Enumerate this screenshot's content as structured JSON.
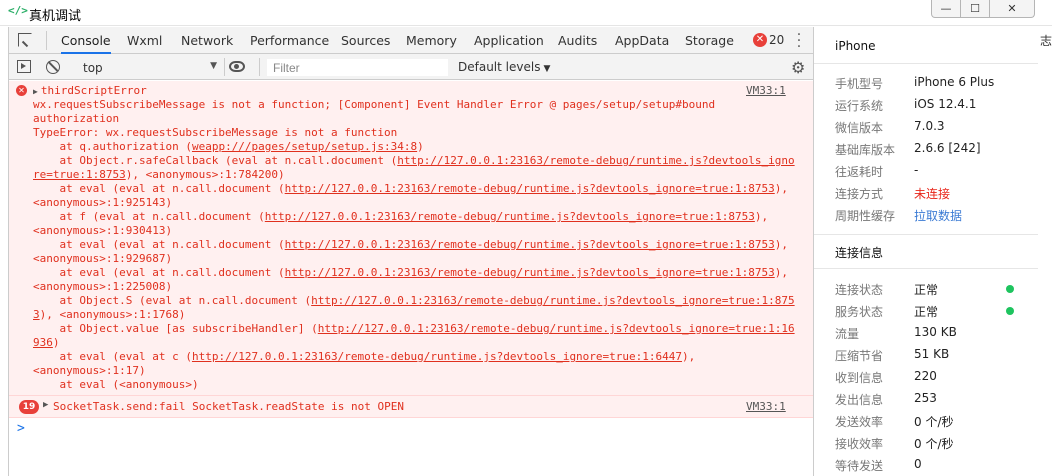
{
  "window": {
    "icon": "</>",
    "title": "真机调试",
    "controls": {
      "min": "—",
      "max": "☐",
      "close": "✕"
    }
  },
  "tabs": [
    "Console",
    "Wxml",
    "Network",
    "Performance",
    "Sources",
    "Memory",
    "Application",
    "Audits",
    "AppData",
    "Storage"
  ],
  "error_count": "20",
  "toolbar": {
    "context": "top",
    "filter_placeholder": "Filter",
    "levels": "Default levels"
  },
  "console": {
    "error1": {
      "source": "VM33:1",
      "lines": [
        [
          {
            "t": "thirdScriptError"
          }
        ],
        [
          {
            "t": "wx.requestSubscribeMessage is not a function; [Component] Event Handler Error @ pages/setup/setup#bound"
          }
        ],
        [
          {
            "t": "authorization"
          }
        ],
        [
          {
            "t": "TypeError: wx.requestSubscribeMessage is not a function"
          }
        ],
        [
          {
            "t": "    at q.authorization ("
          },
          {
            "t": "weapp:///pages/setup/setup.js:34:8",
            "u": 1
          },
          {
            "t": ")"
          }
        ],
        [
          {
            "t": "    at Object.r.safeCallback (eval at n.call.document ("
          },
          {
            "t": "http://127.0.0.1:23163/remote-debug/runtime.js?devtools_igno",
            "u": 1
          }
        ],
        [
          {
            "t": "re=true:1:8753",
            "u": 1
          },
          {
            "t": "), <anonymous>:1:784200)"
          }
        ],
        [
          {
            "t": "    at eval (eval at n.call.document ("
          },
          {
            "t": "http://127.0.0.1:23163/remote-debug/runtime.js?devtools_ignore=true:1:8753",
            "u": 1
          },
          {
            "t": "),"
          }
        ],
        [
          {
            "t": "<anonymous>:1:925143)"
          }
        ],
        [
          {
            "t": "    at f (eval at n.call.document ("
          },
          {
            "t": "http://127.0.0.1:23163/remote-debug/runtime.js?devtools_ignore=true:1:8753",
            "u": 1
          },
          {
            "t": "),"
          }
        ],
        [
          {
            "t": "<anonymous>:1:930413)"
          }
        ],
        [
          {
            "t": "    at eval (eval at n.call.document ("
          },
          {
            "t": "http://127.0.0.1:23163/remote-debug/runtime.js?devtools_ignore=true:1:8753",
            "u": 1
          },
          {
            "t": "),"
          }
        ],
        [
          {
            "t": "<anonymous>:1:929687)"
          }
        ],
        [
          {
            "t": "    at eval (eval at n.call.document ("
          },
          {
            "t": "http://127.0.0.1:23163/remote-debug/runtime.js?devtools_ignore=true:1:8753",
            "u": 1
          },
          {
            "t": "),"
          }
        ],
        [
          {
            "t": "<anonymous>:1:225008)"
          }
        ],
        [
          {
            "t": "    at Object.S (eval at n.call.document ("
          },
          {
            "t": "http://127.0.0.1:23163/remote-debug/runtime.js?devtools_ignore=true:1:875",
            "u": 1
          }
        ],
        [
          {
            "t": "3",
            "u": 1
          },
          {
            "t": "), <anonymous>:1:1768)"
          }
        ],
        [
          {
            "t": "    at Object.value [as subscribeHandler] ("
          },
          {
            "t": "http://127.0.0.1:23163/remote-debug/runtime.js?devtools_ignore=true:1:16",
            "u": 1
          }
        ],
        [
          {
            "t": "936",
            "u": 1
          },
          {
            "t": ")"
          }
        ],
        [
          {
            "t": "    at eval (eval at c ("
          },
          {
            "t": "http://127.0.0.1:23163/remote-debug/runtime.js?devtools_ignore=true:1:6447",
            "u": 1
          },
          {
            "t": "),"
          }
        ],
        [
          {
            "t": "<anonymous>:1:17)"
          }
        ],
        [
          {
            "t": "    at eval (<anonymous>)"
          }
        ]
      ]
    },
    "error2": {
      "count": "19",
      "text": "SocketTask.send:fail SocketTask.readState is not OPEN",
      "source": "VM33:1"
    },
    "prompt": ">"
  },
  "device_info": {
    "title": "iPhone",
    "rows": [
      {
        "label": "手机型号",
        "value": "iPhone 6 Plus",
        "color": "#222222"
      },
      {
        "label": "运行系统",
        "value": "iOS 12.4.1",
        "color": "#222222"
      },
      {
        "label": "微信版本",
        "value": "7.0.3",
        "color": "#222222"
      },
      {
        "label": "基础库版本",
        "value": "2.6.6 [242]",
        "color": "#222222"
      },
      {
        "label": "往返耗时",
        "value": "-",
        "color": "#222222"
      },
      {
        "label": "连接方式",
        "value": "未连接",
        "color": "#e8261a"
      },
      {
        "label": "周期性缓存",
        "value": "拉取数据",
        "color": "#3b7bd4"
      }
    ]
  },
  "connection_info": {
    "title": "连接信息",
    "rows": [
      {
        "label": "连接状态",
        "value": "正常",
        "dot": true
      },
      {
        "label": "服务状态",
        "value": "正常",
        "dot": true
      },
      {
        "label": "流量",
        "value": "130 KB"
      },
      {
        "label": "压缩节省",
        "value": "51 KB"
      },
      {
        "label": "收到信息",
        "value": "220"
      },
      {
        "label": "发出信息",
        "value": "253"
      },
      {
        "label": "发送效率",
        "value": "0 个/秒"
      },
      {
        "label": "接收效率",
        "value": "0 个/秒"
      },
      {
        "label": "等待发送",
        "value": "0"
      }
    ]
  },
  "right_edge_text": "志"
}
